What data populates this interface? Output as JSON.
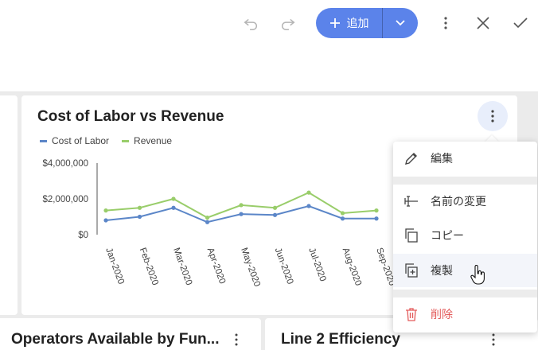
{
  "toolbar": {
    "add_label": "追加",
    "icons": [
      "undo-icon",
      "redo-icon",
      "plus-icon",
      "chevron-down-icon",
      "more-vert-icon",
      "close-icon",
      "check-icon"
    ]
  },
  "cards": {
    "main_title": "Cost of Labor vs Revenue",
    "bottom_left_title": "Operators Available by Fun...",
    "bottom_right_title": "Line 2 Efficiency"
  },
  "context_menu": {
    "items": [
      {
        "label": "編集",
        "icon": "pencil-icon"
      },
      {
        "label": "名前の変更",
        "icon": "rename-icon"
      },
      {
        "label": "コピー",
        "icon": "copy-icon"
      },
      {
        "label": "複製",
        "icon": "duplicate-icon"
      },
      {
        "label": "削除",
        "icon": "trash-icon"
      }
    ]
  },
  "colors": {
    "accent": "#5b83ea",
    "cost_of_labor": "#5b86c8",
    "revenue": "#99cd6a",
    "danger": "#e35a5a"
  },
  "chart_data": {
    "type": "line",
    "categories": [
      "Jan-2020",
      "Feb-2020",
      "Mar-2020",
      "Apr-2020",
      "May-2020",
      "Jun-2020",
      "Jul-2020",
      "Aug-2020",
      "Sep-2020"
    ],
    "series": [
      {
        "name": "Cost of Labor",
        "values": [
          800000,
          1000000,
          1500000,
          700000,
          1150000,
          1100000,
          1600000,
          900000,
          900000
        ]
      },
      {
        "name": "Revenue",
        "values": [
          1350000,
          1500000,
          2000000,
          950000,
          1650000,
          1500000,
          2350000,
          1200000,
          1350000
        ]
      }
    ],
    "yticks": [
      {
        "value": 4000000,
        "label": "$4,000,000"
      },
      {
        "value": 2000000,
        "label": "$2,000,000"
      },
      {
        "value": 0,
        "label": "$0"
      }
    ],
    "ylim": [
      0,
      4000000
    ],
    "grid": false,
    "legend_position": "top-left"
  }
}
